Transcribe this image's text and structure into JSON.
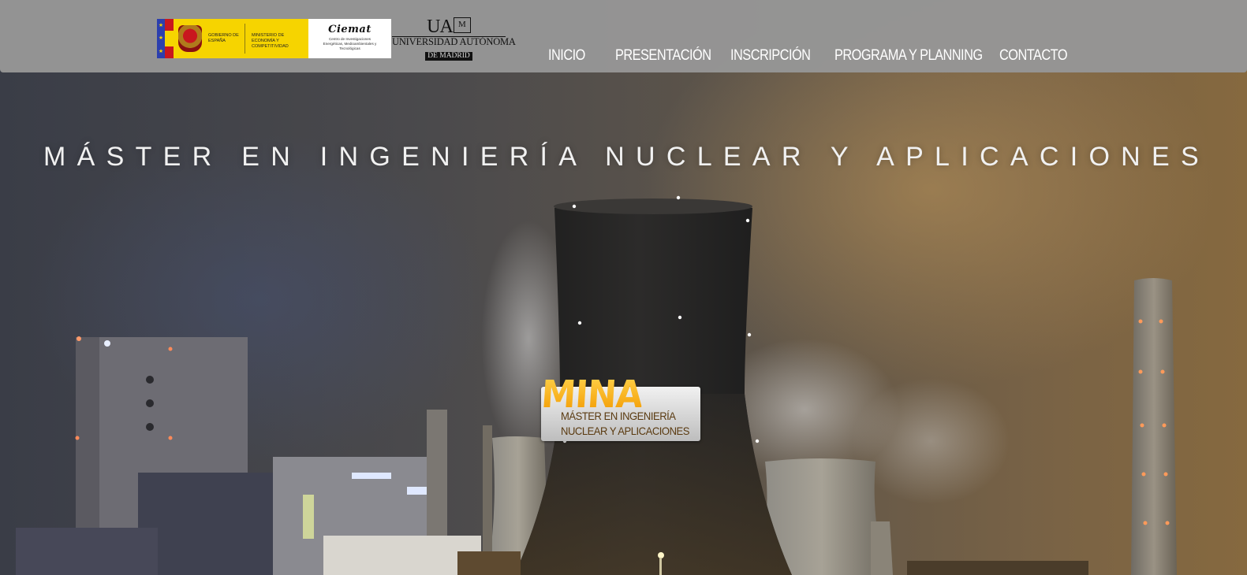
{
  "header": {
    "logos": {
      "gobierno": {
        "line1": "Gobierno de España",
        "line2": "Ministerio de Economía y Competitividad"
      },
      "ciemat": {
        "name": "Ciemat",
        "subtitle": "Centro de Investigaciones Energéticas, Medioambientales y Tecnológicas"
      },
      "uam": {
        "mark": "UA",
        "name": "UNIVERSIDAD AUTÓNOMA",
        "sub": "DE MADRID"
      }
    },
    "nav": [
      {
        "label": "INICIO"
      },
      {
        "label": "PRESENTACIÓN"
      },
      {
        "label": "INSCRIPCIÓN"
      },
      {
        "label": "PROGRAMA Y PLANNING"
      },
      {
        "label": "CONTACTO"
      }
    ]
  },
  "hero": {
    "title": "MÁSTER EN INGENIERÍA NUCLEAR Y APLICACIONES",
    "badge": {
      "acronym": "MINA",
      "line1": "MÁSTER EN INGENIERÍA",
      "line2": "NUCLEAR Y APLICACIONES"
    }
  },
  "colors": {
    "header_bg": "#969696",
    "nav_text": "#ffffff",
    "badge_orange": "#f39a00"
  }
}
